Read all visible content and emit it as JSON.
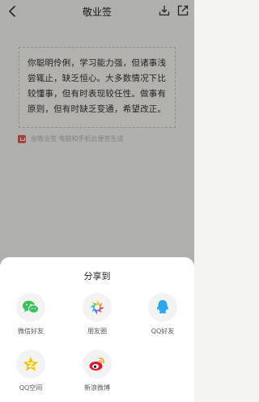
{
  "header": {
    "title": "敬业签"
  },
  "card": {
    "text": "你聪明伶俐，学习能力强，但诸事浅尝辄止，缺乏恒心。大多数情况下比较懂事，但有时表现较任性。做事有原则，但有时缺乏变通，希望改正。"
  },
  "footer": {
    "text": "由敬业签 电脑和手机云便签生成"
  },
  "share_sheet": {
    "title": "分享到",
    "items": [
      {
        "label": "微信好友",
        "icon": "wechat-icon"
      },
      {
        "label": "朋友圈",
        "icon": "moments-icon"
      },
      {
        "label": "QQ好友",
        "icon": "qq-icon"
      },
      {
        "label": "QQ空间",
        "icon": "qzone-icon"
      },
      {
        "label": "新浪微博",
        "icon": "weibo-icon"
      }
    ]
  },
  "colors": {
    "wechat": "#3cc05a",
    "qq": "#2ba6f0",
    "qzone": "#f5c400",
    "weibo": "#e6162d"
  }
}
